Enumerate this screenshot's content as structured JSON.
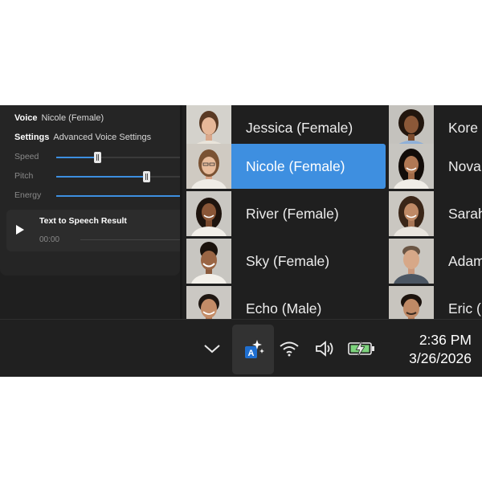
{
  "settings": {
    "voice_label": "Voice",
    "voice_value": "Nicole (Female)",
    "settings_label": "Settings",
    "settings_value": "Advanced Voice Settings",
    "sliders": [
      {
        "label": "Speed",
        "value": 0.33
      },
      {
        "label": "Pitch",
        "value": 0.73
      },
      {
        "label": "Energy",
        "value": 1.0
      }
    ]
  },
  "result": {
    "title": "Text to Speech Result",
    "time": "00:00"
  },
  "voices": {
    "column1": [
      {
        "name": "Jessica (Female)",
        "selected": false
      },
      {
        "name": "Nicole (Female)",
        "selected": true
      },
      {
        "name": "River (Female)",
        "selected": false
      },
      {
        "name": "Sky (Female)",
        "selected": false
      },
      {
        "name": "Echo (Male)",
        "selected": false
      }
    ],
    "column2": [
      {
        "name": "Kore"
      },
      {
        "name": "Nova"
      },
      {
        "name": "Sarah"
      },
      {
        "name": "Adam"
      },
      {
        "name": "Eric ("
      }
    ]
  },
  "taskbar": {
    "icons": [
      "chevron-up-icon",
      "sparkle-translate-icon",
      "wifi-icon",
      "volume-icon",
      "battery-charging-icon"
    ],
    "time": "2:36 PM",
    "date": "3/26/2026"
  },
  "colors": {
    "accent": "#3e8fe0",
    "background": "#1f1f1f",
    "battery": "#7dd37d"
  }
}
